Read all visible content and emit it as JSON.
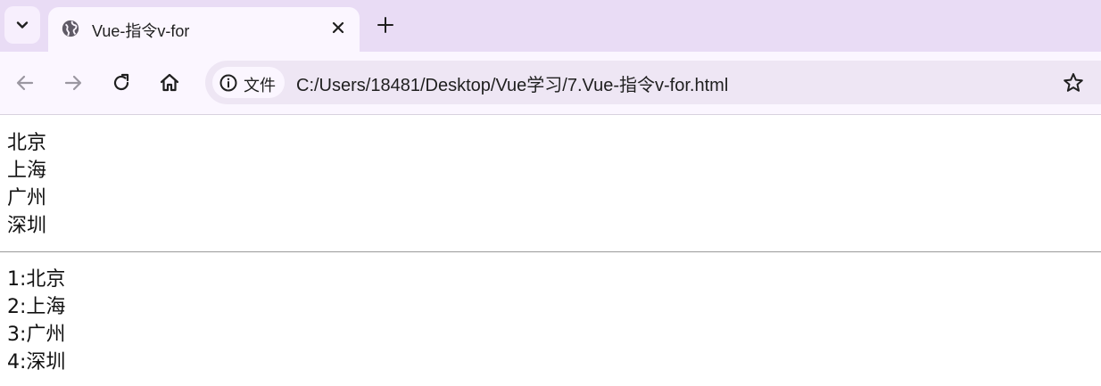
{
  "browser": {
    "tab_title": "Vue-指令v-for",
    "address_chip_label": "文件",
    "url": "C:/Users/18481/Desktop/Vue学习/7.Vue-指令v-for.html"
  },
  "content": {
    "cities": [
      "北京",
      "上海",
      "广州",
      "深圳"
    ],
    "indexed_cities": [
      "1:北京",
      "2:上海",
      "3:广州",
      "4:深圳"
    ]
  },
  "icons": [
    "chevron-down-icon",
    "globe-icon",
    "close-icon",
    "plus-icon",
    "back-arrow-icon",
    "forward-arrow-icon",
    "reload-icon",
    "home-icon",
    "info-icon",
    "star-icon"
  ],
  "colors": {
    "tabbar_bg": "#e9dcf5",
    "toolbar_bg": "#fbf6ff",
    "omnibox_bg": "#eee6f4",
    "divider": "#9a9a9a"
  }
}
